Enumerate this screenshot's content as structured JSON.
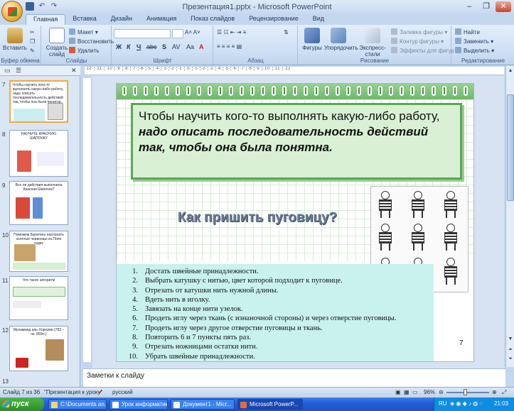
{
  "titlebar": {
    "title": "Презентация1.pptx - Microsoft PowerPoint",
    "minimize": "–",
    "maximize": "❐",
    "close": "✕"
  },
  "qat": {
    "save_icon": "save-icon",
    "undo": "↶",
    "redo": "↷"
  },
  "tabs": [
    "Главная",
    "Вставка",
    "Дизайн",
    "Анимация",
    "Показ слайдов",
    "Рецензирование",
    "Вид"
  ],
  "ribbon": {
    "clipboard": {
      "label": "Буфер обмена",
      "paste": "Вставить"
    },
    "slides": {
      "label": "Слайды",
      "create": "Создать слайд",
      "layout": "Макет",
      "reset": "Восстановить",
      "delete": "Удалить"
    },
    "font": {
      "label": "Шрифт",
      "bold": "Ж",
      "italic": "К",
      "underline": "Ч",
      "strike": "abc",
      "shadow": "S",
      "spacing": "AV",
      "case": "Aa",
      "color": "A"
    },
    "paragraph": {
      "label": "Абзац"
    },
    "drawing": {
      "label": "Рисование",
      "shapes": "Фигуры",
      "arrange": "Упорядочить",
      "quick_styles": "Экспресс-стили",
      "fill": "Заливка фигуры",
      "outline": "Контур фигуры",
      "effects": "Эффекты для фигур"
    },
    "editing": {
      "label": "Редактирование",
      "find": "Найти",
      "replace": "Заменить",
      "select": "Выделить"
    }
  },
  "ruler_text": "·12·¦·11·¦·10·¦·9·¦·8·¦·7·¦·6·¦·5·¦·4·¦·3·¦·2·¦·1·¦·0·¦·1·¦·2·¦·3·¦·4·¦·5·¦·6·¦·7·¦·8·¦·9·¦·10·¦·11·¦·12·",
  "panel": {
    "thumbs": [
      {
        "num": "7",
        "title": "Чтобы научить кого-то выполнять какую-либо работу, надо описать последовательность действий так, чтобы она была понятна."
      },
      {
        "num": "8",
        "title": "НАУЧИТЕ КРАСНУЮ ШАПОЧКУ"
      },
      {
        "num": "9",
        "title": "Все ли действия выполнила Красная Шапочка?"
      },
      {
        "num": "10",
        "title": "Поможем Буратино нахлопать золотые червонцы на Поле чудес"
      },
      {
        "num": "11",
        "title": "Что такое алгоритм"
      },
      {
        "num": "12",
        "title": "Мухаммед аль-Хорезми (783 – ок. 850гг.)"
      }
    ],
    "next_num": "13"
  },
  "slide": {
    "intro_normal": "Чтобы научить кого-то выполнять какую-либо работу,",
    "intro_emph": "надо описать последовательность действий так, чтобы она была понятна.",
    "subtitle": "Как пришить пуговицу?",
    "steps": [
      {
        "n": "1.",
        "text": "Достать швейные принадлежности."
      },
      {
        "n": "2.",
        "text": "Выбрать катушку с нитью, цвет которой подходит к пуговице."
      },
      {
        "n": "3.",
        "text": "Отрезать от катушки нить нужной длины."
      },
      {
        "n": "4.",
        "text": "Вдеть нить в иголку."
      },
      {
        "n": "5.",
        "text": "Завязать на конце нити узелок."
      },
      {
        "n": "6.",
        "text": "Продеть иглу через ткань (с изнаночной стороны) и через отверстие пуговицы."
      },
      {
        "n": "7.",
        "text": "Продеть иглу через другое отверстие пуговицы и ткань."
      },
      {
        "n": "8.",
        "text": "Повторить 6 и 7 пункты пять раз."
      },
      {
        "n": "9.",
        "text": "Отрезать ножницами остатки нити."
      },
      {
        "n": "10.",
        "text": "Убрать швейные принадлежности."
      }
    ],
    "page_number": "7",
    "colors": {
      "frame": "#59a954",
      "box": "#d9f0d5",
      "steps_bg": "#c9f2ef"
    }
  },
  "notes": {
    "placeholder": "Заметки к слайду"
  },
  "statusbar": {
    "slide": "Слайд 7 из 36",
    "theme": "\"Презентация к уроку\"",
    "lang": "русский",
    "zoom": "96%"
  },
  "taskbar": {
    "start": "пуск",
    "tasks": [
      "C:\\Documents an...",
      "Урок информатик...",
      "Документ1 - Micr...",
      "Microsoft PowerP..."
    ],
    "lang": "RU",
    "clock": "21:03"
  }
}
